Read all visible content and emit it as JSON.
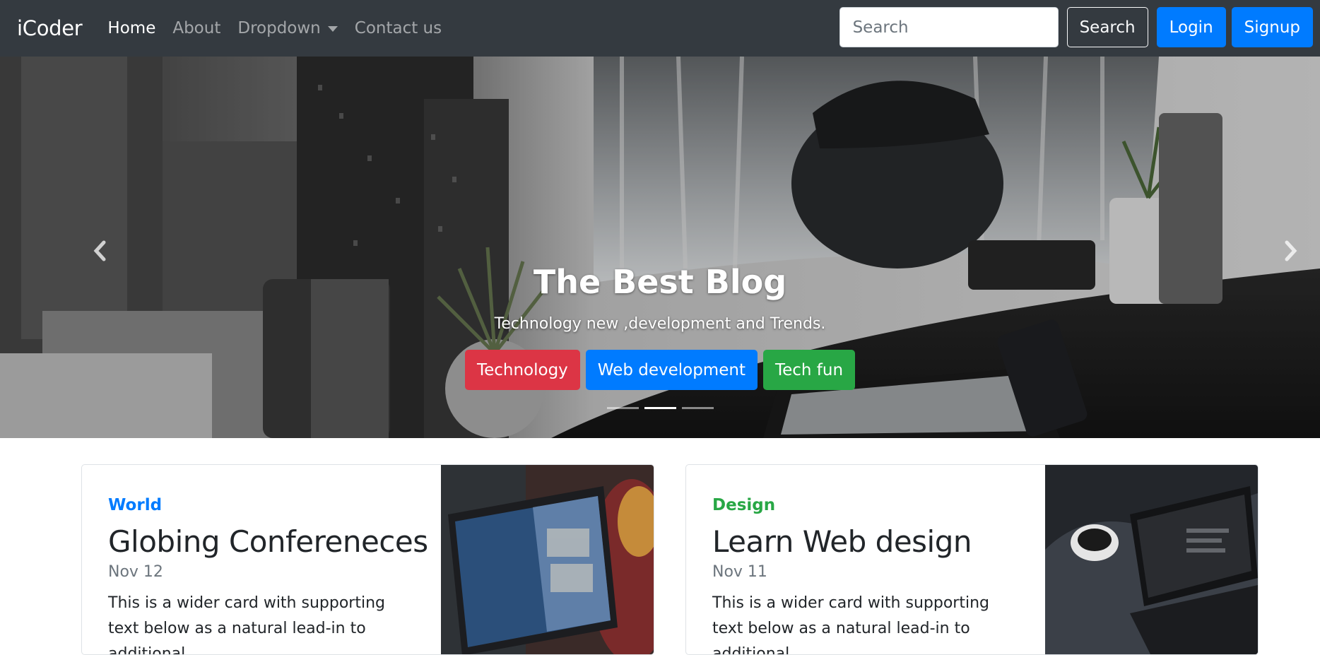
{
  "navbar": {
    "brand": "iCoder",
    "links": [
      {
        "label": "Home"
      },
      {
        "label": "About"
      },
      {
        "label": "Dropdown"
      },
      {
        "label": "Contact us"
      }
    ],
    "search_placeholder": "Search",
    "search_button": "Search",
    "login_button": "Login",
    "signup_button": "Signup"
  },
  "carousel": {
    "title": "The Best Blog",
    "subtitle": "Technology new ,development and Trends.",
    "buttons": [
      {
        "label": "Technology",
        "color": "#dc3545"
      },
      {
        "label": "Web development",
        "color": "#007bff"
      },
      {
        "label": "Tech fun",
        "color": "#28a745"
      }
    ],
    "active_slide": 2,
    "slide_count": 3
  },
  "cards": [
    {
      "category": "World",
      "category_color": "#007bff",
      "title": "Globing Confereneces",
      "date": "Nov 12",
      "text": "This is a wider card with supporting text below as a natural lead-in to additional"
    },
    {
      "category": "Design",
      "category_color": "#28a745",
      "title": "Learn Web design",
      "date": "Nov 11",
      "text": "This is a wider card with supporting text below as a natural lead-in to additional"
    }
  ],
  "colors": {
    "navbar_bg": "#343a40",
    "primary": "#007bff",
    "danger": "#dc3545",
    "success": "#28a745"
  },
  "icons": {
    "prev": "chevron-left-icon",
    "next": "chevron-right-icon",
    "dropdown": "caret-down-icon"
  }
}
